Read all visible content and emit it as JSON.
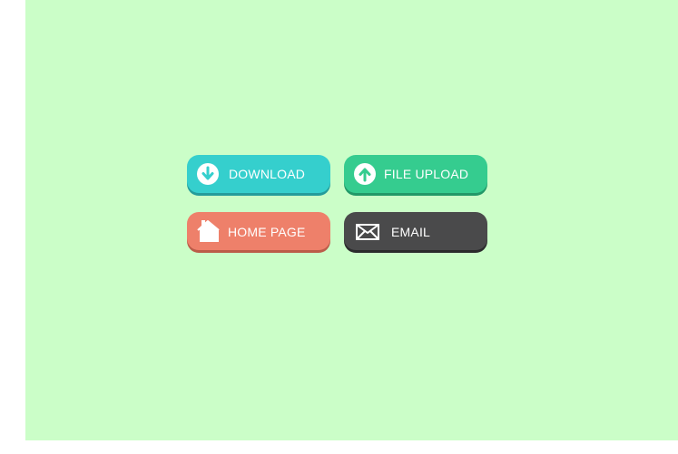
{
  "buttons": {
    "download": {
      "label": "DOWNLOAD",
      "icon": "download-arrow-circle-icon",
      "color": "#35cfcd"
    },
    "file_upload": {
      "label": "FILE UPLOAD",
      "icon": "upload-arrow-circle-icon",
      "color": "#35cc8f"
    },
    "home_page": {
      "label": "HOME PAGE",
      "icon": "house-icon",
      "color": "#ee806a"
    },
    "email": {
      "label": "EMAIL",
      "icon": "envelope-icon",
      "color": "#4a4a4b"
    }
  },
  "background_color": "#cbfec8"
}
